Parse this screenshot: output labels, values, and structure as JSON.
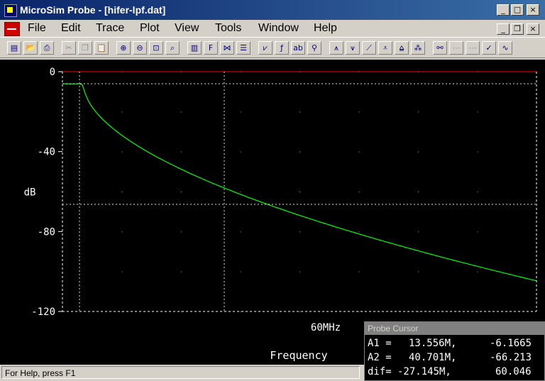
{
  "window": {
    "title": "MicroSim Probe - [hifer-lpf.dat]",
    "controls": [
      "_",
      "□",
      "×"
    ],
    "doc_controls": [
      "_",
      "❐",
      "×"
    ]
  },
  "menu": [
    "File",
    "Edit",
    "Trace",
    "Plot",
    "View",
    "Tools",
    "Window",
    "Help"
  ],
  "toolbar": [
    {
      "name": "new-icon",
      "glyph": "▤",
      "enabled": true
    },
    {
      "name": "open-icon",
      "glyph": "📂",
      "enabled": true
    },
    {
      "name": "print-icon",
      "glyph": "⎙",
      "enabled": true
    },
    {
      "name": "cut-icon",
      "glyph": "✂",
      "enabled": false
    },
    {
      "name": "copy-icon",
      "glyph": "❐",
      "enabled": false
    },
    {
      "name": "paste-icon",
      "glyph": "📋",
      "enabled": false
    },
    {
      "name": "zoom-in-icon",
      "glyph": "⊕",
      "enabled": true
    },
    {
      "name": "zoom-out-icon",
      "glyph": "⊖",
      "enabled": true
    },
    {
      "name": "zoom-area-icon",
      "glyph": "⊡",
      "enabled": true
    },
    {
      "name": "zoom-fit-icon",
      "glyph": "⌕",
      "enabled": true
    },
    {
      "name": "log-x-icon",
      "glyph": "▥",
      "enabled": true
    },
    {
      "name": "fft-icon",
      "glyph": "F",
      "enabled": true
    },
    {
      "name": "performance-icon",
      "glyph": "⋈",
      "enabled": true
    },
    {
      "name": "list-icon",
      "glyph": "☰",
      "enabled": true
    },
    {
      "name": "add-trace-icon",
      "glyph": "⩗",
      "enabled": true
    },
    {
      "name": "eval-goal-icon",
      "glyph": "ƒ",
      "enabled": true
    },
    {
      "name": "add-label-icon",
      "glyph": "ab",
      "enabled": true
    },
    {
      "name": "marker-icon",
      "glyph": "⚲",
      "enabled": true
    },
    {
      "name": "cursor-peak-icon",
      "glyph": "⩚",
      "enabled": true
    },
    {
      "name": "cursor-trough-icon",
      "glyph": "⩛",
      "enabled": true
    },
    {
      "name": "cursor-slope-icon",
      "glyph": "⟋",
      "enabled": true
    },
    {
      "name": "cursor-min-icon",
      "glyph": "⩡",
      "enabled": true
    },
    {
      "name": "cursor-max-icon",
      "glyph": "⩠",
      "enabled": true
    },
    {
      "name": "cursor-point-icon",
      "glyph": "⁂",
      "enabled": true
    },
    {
      "name": "cursor-search-icon",
      "glyph": "⚯",
      "enabled": true
    },
    {
      "name": "cursor-next-icon",
      "glyph": "⋯",
      "enabled": false
    },
    {
      "name": "cursor-prev-icon",
      "glyph": "⋯",
      "enabled": false
    },
    {
      "name": "mark-label-icon",
      "glyph": "✓",
      "enabled": true
    },
    {
      "name": "mark-data-icon",
      "glyph": "∿",
      "enabled": true
    }
  ],
  "colors": {
    "plot_bg": "#000000",
    "trace": "#00ff00",
    "reference": "#ff0000",
    "axis": "#ffffff",
    "grid": "#a0a0a0",
    "cursor": "#e0e0e0",
    "tick_text": "#ffffff"
  },
  "chart_data": {
    "type": "line",
    "xlabel": "Frequency",
    "ylabel": "dB",
    "x_tick_labels": [
      "60MHz"
    ],
    "y_tick_labels": [
      "0",
      "-40",
      "-80",
      "-120"
    ],
    "ylim": [
      -120,
      0
    ],
    "xlim_mhz": [
      0,
      160
    ],
    "grid": "dotted",
    "series": [
      {
        "x_mhz": [
          0,
          5,
          10,
          13.556,
          16,
          20,
          25,
          30,
          35,
          40.701,
          45,
          50,
          60,
          70,
          80,
          90,
          100,
          110,
          120,
          130,
          140,
          150,
          160
        ],
        "y_db": [
          -6.0,
          -6.05,
          -6.1,
          -6.17,
          -14,
          -26,
          -36,
          -44,
          -51,
          -66.2,
          -61,
          -65,
          -72,
          -78,
          -83,
          -87,
          -91,
          -94,
          -97,
          -99.5,
          -102,
          -104,
          -106
        ]
      },
      {
        "x_mhz": [
          0,
          160
        ],
        "y_db": [
          0,
          0
        ]
      }
    ],
    "cursors": {
      "A1": {
        "x_mhz": 13.556,
        "y_db": -6.1665
      },
      "A2": {
        "x_mhz": 40.701,
        "y_db": -66.213
      }
    }
  },
  "probe_cursor": {
    "title": "Probe Cursor",
    "rows": [
      {
        "label": "A1 =",
        "x": "13.556M,",
        "y": "-6.1665"
      },
      {
        "label": "A2 =",
        "x": "40.701M,",
        "y": "-66.213"
      },
      {
        "label": "dif=",
        "x": "-27.145M,",
        "y": "60.046"
      }
    ]
  },
  "status": {
    "text": "For Help, press F1"
  }
}
